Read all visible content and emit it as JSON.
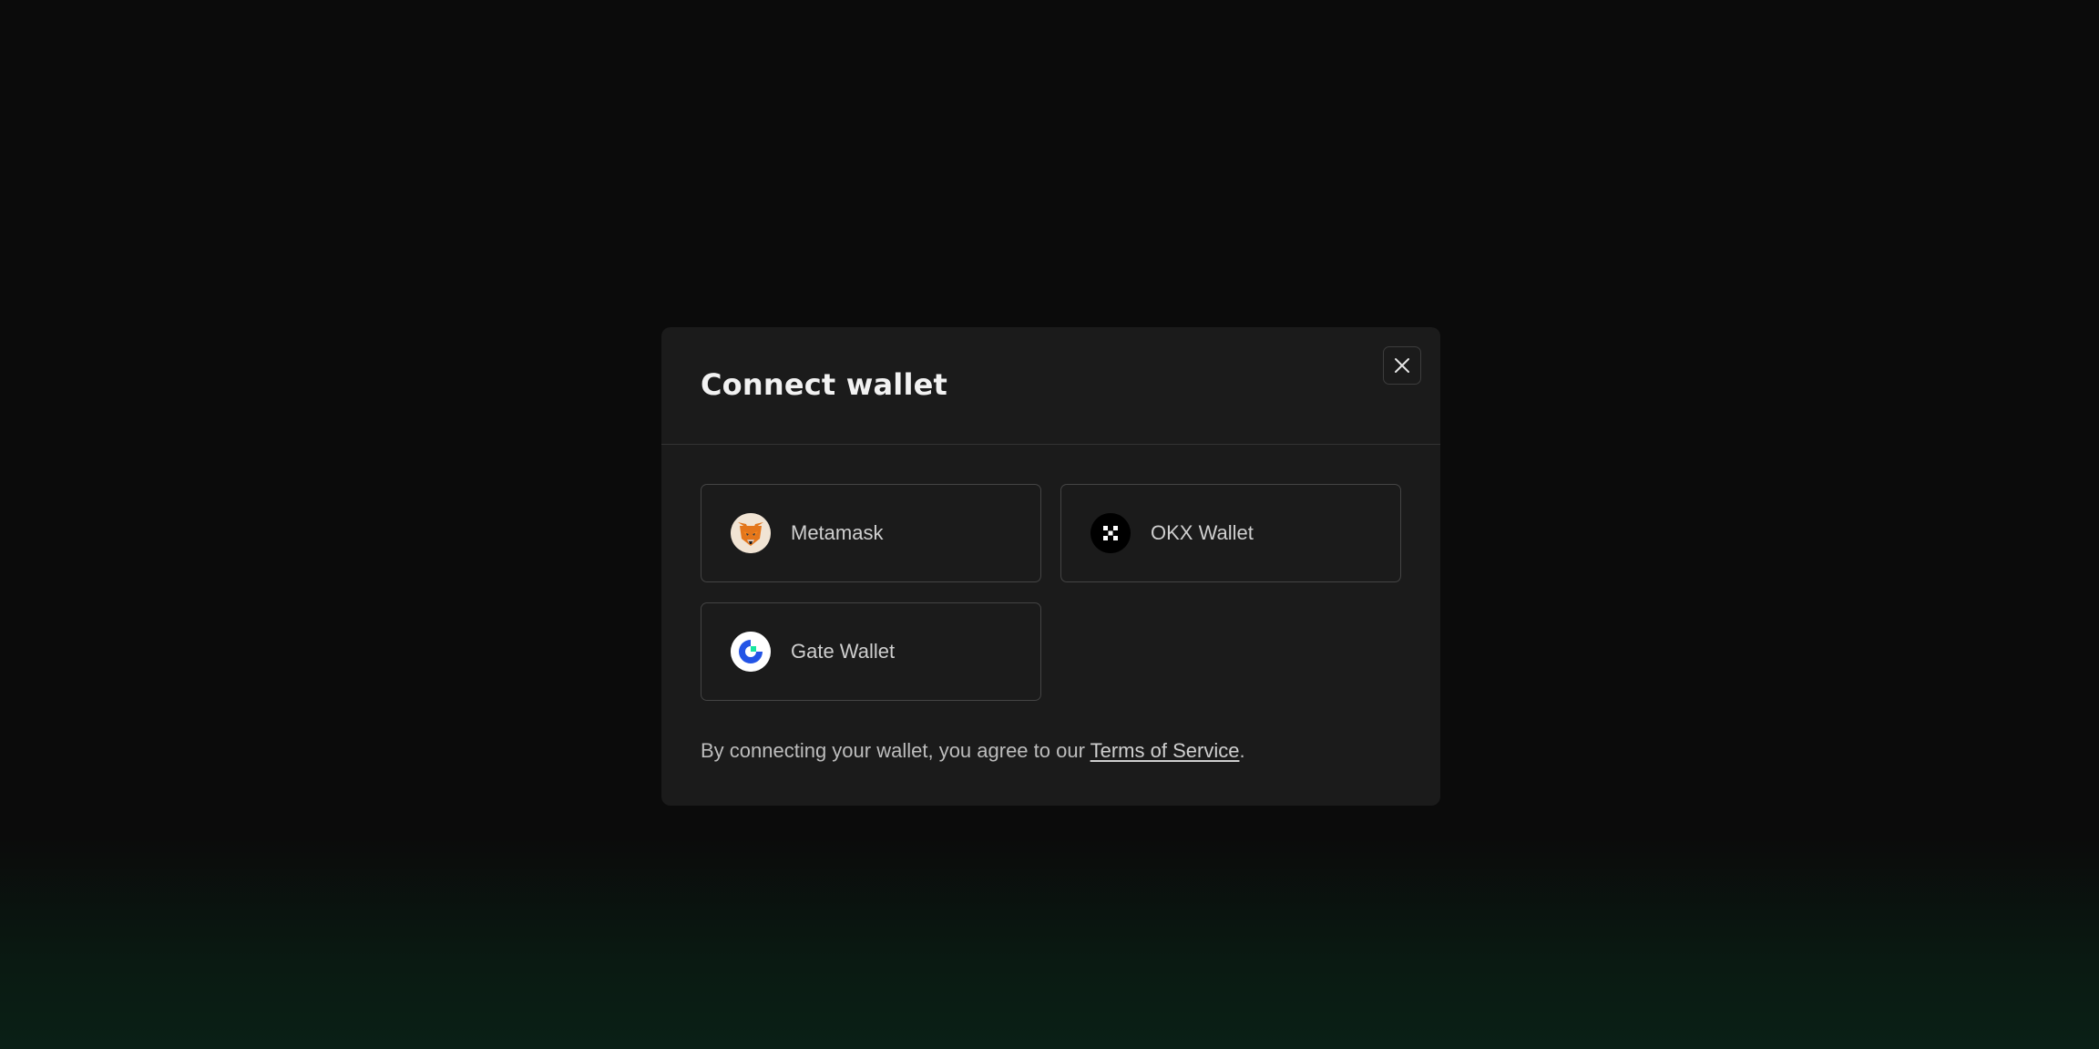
{
  "modal": {
    "title": "Connect wallet",
    "close_icon": "close-icon"
  },
  "wallets": [
    {
      "name": "Metamask",
      "icon": "metamask-fox-icon"
    },
    {
      "name": "OKX Wallet",
      "icon": "okx-logo-icon"
    },
    {
      "name": "Gate Wallet",
      "icon": "gate-logo-icon"
    }
  ],
  "footer": {
    "prefix": "By connecting your wallet, you agree to our ",
    "link": "Terms of Service",
    "suffix": "."
  },
  "colors": {
    "background": "#0b0b0b",
    "modal": "#1b1b1b",
    "border": "#444444",
    "accent_green": "#0a2016"
  }
}
